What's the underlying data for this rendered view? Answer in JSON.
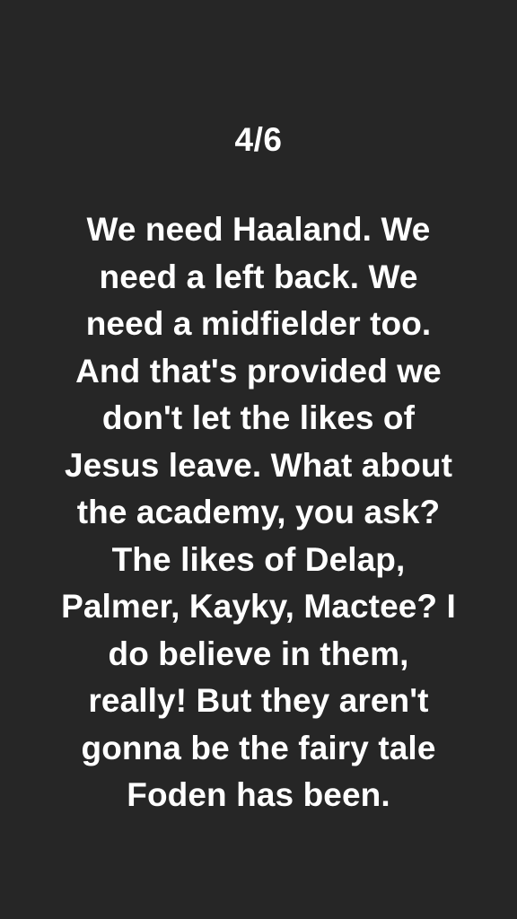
{
  "story": {
    "page_indicator": "4/6",
    "lines": [
      "We need Haaland. We",
      "need a left back. We",
      "need a midfielder too.",
      "And that's provided we",
      "don't let the likes of",
      "Jesus leave. What about",
      "the academy, you ask?",
      "The likes of Delap,",
      "Palmer, Kayky, Mactee? I",
      "do believe in them,",
      "really! But they aren't",
      "gonna be the fairy tale",
      "Foden has been."
    ]
  },
  "colors": {
    "background": "#262626",
    "text": "#ffffff"
  }
}
